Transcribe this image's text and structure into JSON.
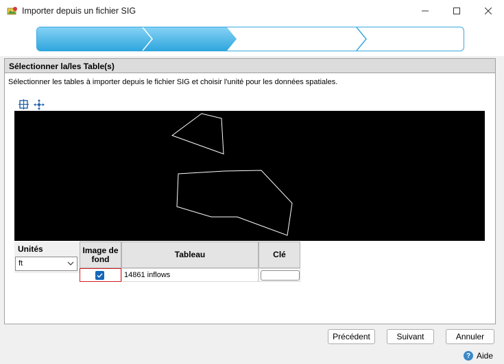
{
  "window": {
    "title": "Importer depuis un fichier SIG",
    "icon": "map-import-icon"
  },
  "wizard": {
    "total_steps": 3,
    "completed_steps": 2
  },
  "section": {
    "header": "Sélectionner la/les Table(s)",
    "description": "Sélectionner les tables à importer depuis le fichier SIG et choisir l'unité pour les données spatiales."
  },
  "toolbar": {
    "icons": [
      "zoom-extent-icon",
      "pan-icon"
    ]
  },
  "units": {
    "label": "Unités",
    "value": "ft"
  },
  "table": {
    "headers": {
      "image": "Image de fond",
      "table": "Tableau",
      "key": "Clé"
    },
    "rows": [
      {
        "image_checked": true,
        "table": "14861 inflows",
        "key": ""
      }
    ]
  },
  "buttons": {
    "previous": "Précédent",
    "next": "Suivant",
    "cancel": "Annuler",
    "help": "Aide"
  },
  "colors": {
    "accent": "#2fa6dd",
    "checkbox": "#1667b8",
    "highlight": "#d21f1f",
    "canvas": "#000000"
  }
}
